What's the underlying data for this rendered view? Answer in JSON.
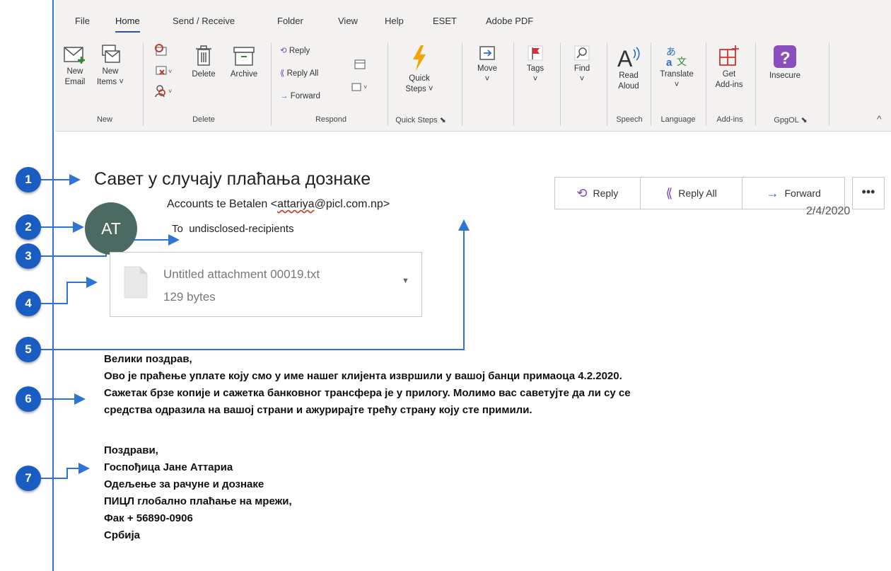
{
  "ribbon": {
    "tabs": [
      "File",
      "Home",
      "Send / Receive",
      "Folder",
      "View",
      "Help",
      "ESET",
      "Adobe PDF"
    ],
    "new_email": [
      "New",
      "Email"
    ],
    "new_items": [
      "New",
      "Items ˅"
    ],
    "delete": "Delete",
    "archive": "Archive",
    "reply": "Reply",
    "reply_all": "Reply All",
    "forward": "Forward",
    "quick_steps": [
      "Quick",
      "Steps ˅"
    ],
    "move": "Move",
    "tags": "Tags",
    "find": "Find",
    "read_aloud": [
      "Read",
      "Aloud"
    ],
    "translate": "Translate",
    "get_addins": [
      "Get",
      "Add-ins"
    ],
    "insecure": "Insecure",
    "groups": [
      "New",
      "Delete",
      "Respond",
      "Quick Steps",
      "Speech",
      "Language",
      "Add-ins",
      "GpgOL"
    ]
  },
  "callouts": [
    "1",
    "2",
    "3",
    "4",
    "5",
    "6",
    "7"
  ],
  "message": {
    "subject": "Савет у случају плаћања дознаке",
    "avatar_initials": "AT",
    "sender_name": "Accounts te Betalen <",
    "sender_address": "attariya",
    "sender_domain": "@picl.com.np>",
    "to_label": "To",
    "to_value": "undisclosed-recipients",
    "date": "2/4/2020",
    "actions": {
      "reply": "Reply",
      "reply_all": "Reply All",
      "forward": "Forward",
      "more": "•••"
    },
    "attachment": {
      "name": "Untitled attachment 00019.txt",
      "size": "129 bytes"
    },
    "body": [
      "Велики поздрав,",
      "Ово је праћење уплате коју смо у име нашег клијента извршили у вашој банци примаоца 4.2.2020.",
      "Сажетак брзе копије и сажетка банковног трансфера је у прилогу.  Молимо вас саветујте да ли су се",
      "средства одразила на вашој страни и ажурирајте трећу страну коју сте примили."
    ],
    "signature": [
      "Поздрави,",
      "Госпођица Јане Аттариа",
      "Одељење за рачуне и дознаке",
      "ПИЦЛ  глобално плаћање на мрежи,",
      "Фак + 56890-0906",
      "Србија"
    ]
  },
  "colors": {
    "callout": "#1a5dc2",
    "avatar": "#4a6a62",
    "accent": "#2b579a"
  }
}
